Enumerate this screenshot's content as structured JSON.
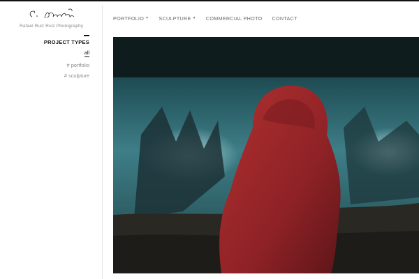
{
  "brand": {
    "subtitle": "Rafael Ruiz Ruiz Photography"
  },
  "nav": {
    "items": [
      {
        "label": "PORTFOLIO",
        "has_dropdown": true
      },
      {
        "label": "SCULPTURE",
        "has_dropdown": true
      },
      {
        "label": "COMMERCIAL PHOTO",
        "has_dropdown": false
      },
      {
        "label": "CONTACT",
        "has_dropdown": false
      }
    ],
    "caret_glyph": "▼"
  },
  "filters": {
    "title": "PROJECT TYPES",
    "items": [
      "all",
      "# portfolio",
      "# sculpture"
    ]
  },
  "colors": {
    "accent": "#111111",
    "nav_text": "#6a6a6a",
    "muted": "#8a8a8a",
    "water": "#2f6a73",
    "cloak": "#9a2528"
  }
}
